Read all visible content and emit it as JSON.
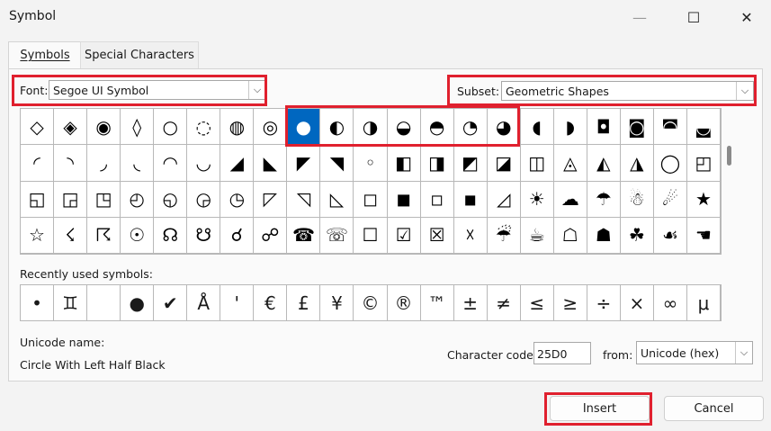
{
  "window": {
    "title": "Symbol",
    "minimize_glyph": "—",
    "maximize_glyph": "☐",
    "close_glyph": "✕"
  },
  "tabs": [
    {
      "label": "Symbols",
      "active": true
    },
    {
      "label": "Special Characters",
      "active": false
    }
  ],
  "font": {
    "label": "Font:",
    "value": "Segoe UI Symbol"
  },
  "subset": {
    "label": "Subset:",
    "value": "Geometric Shapes"
  },
  "dropdown_arrow": "⌵",
  "symbol_grid": {
    "selected_index": 8,
    "cells": [
      "◇",
      "◈",
      "◉",
      "◊",
      "○",
      "◌",
      "◍",
      "◎",
      "●",
      "◐",
      "◑",
      "◒",
      "◓",
      "◔",
      "◕",
      "◖",
      "◗",
      "◘",
      "◙",
      "◚",
      "◛",
      "◜",
      "◝",
      "◞",
      "◟",
      "◠",
      "◡",
      "◢",
      "◣",
      "◤",
      "◥",
      "◦",
      "◧",
      "◨",
      "◩",
      "◪",
      "◫",
      "◬",
      "◭",
      "◮",
      "◯",
      "◰",
      "◱",
      "◲",
      "◳",
      "◴",
      "◵",
      "◶",
      "◷",
      "◸",
      "◹",
      "◺",
      "◻",
      "◼",
      "◽",
      "◾",
      "◿",
      "☀",
      "☁",
      "☂",
      "☃",
      "☄",
      "★",
      "☆",
      "☇",
      "☈",
      "☉",
      "☊",
      "☋",
      "☌",
      "☍",
      "☎",
      "☏",
      "☐",
      "☑",
      "☒",
      "☓",
      "☔",
      "☕",
      "☖",
      "☗",
      "☘",
      "☙",
      "☚"
    ]
  },
  "recent": {
    "label": "Recently used symbols:",
    "cells": [
      "•",
      "♊",
      "",
      "●",
      "✔",
      "Å",
      "'",
      "€",
      "£",
      "¥",
      "©",
      "®",
      "™",
      "±",
      "≠",
      "≤",
      "≥",
      "÷",
      "×",
      "∞",
      "μ"
    ]
  },
  "unicode_name": {
    "label": "Unicode name:",
    "value": "Circle With Left Half Black"
  },
  "character_code": {
    "label": "Character code:",
    "value": "25D0"
  },
  "from": {
    "label": "from:",
    "value": "Unicode (hex)"
  },
  "buttons": {
    "insert": "Insert",
    "cancel": "Cancel"
  },
  "highlight_color": "#e0202e",
  "selection_color": "#0067c0"
}
